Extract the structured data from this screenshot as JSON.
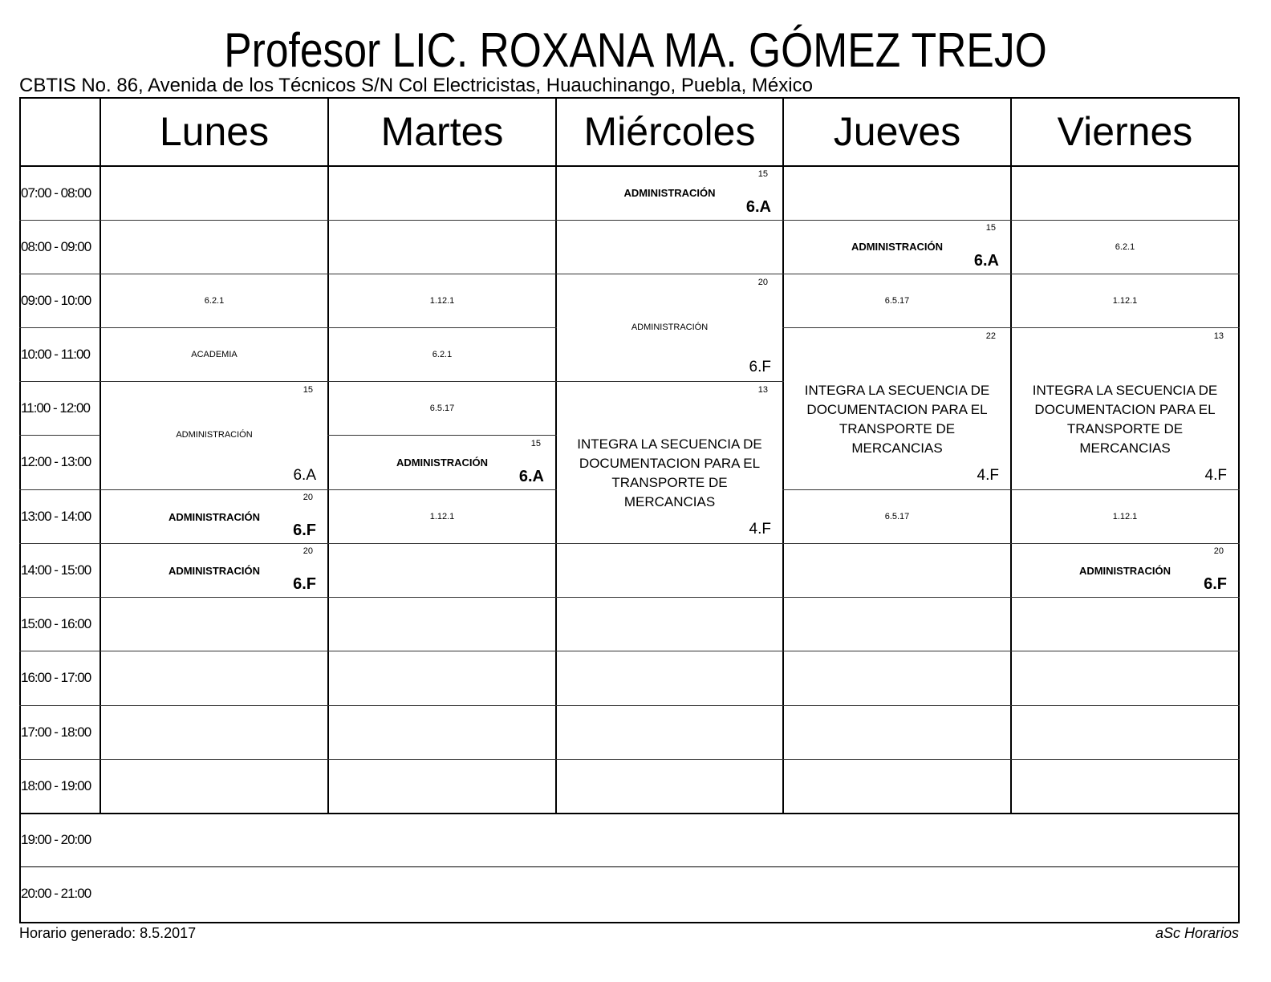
{
  "title": "Profesor LIC. ROXANA MA. GÓMEZ TREJO",
  "address": "CBTIS No. 86, Avenida de los Técnicos S/N Col Electricistas, Huauchinango, Puebla, México",
  "days": [
    "Lunes",
    "Martes",
    "Miércoles",
    "Jueves",
    "Viernes"
  ],
  "times": [
    "07:00 - 08:00",
    "08:00 - 09:00",
    "09:00 - 10:00",
    "10:00 - 11:00",
    "11:00 - 12:00",
    "12:00 - 13:00",
    "13:00 - 14:00",
    "14:00 - 15:00",
    "15:00 - 16:00",
    "16:00 - 17:00",
    "17:00 - 18:00",
    "18:00 - 19:00",
    "19:00 - 20:00",
    "20:00 - 21:00"
  ],
  "lessons": {
    "lun_0900": {
      "text": "6.2.1"
    },
    "lun_1000": {
      "text": "ACADEMIA"
    },
    "lun_1100": {
      "capacity": "15",
      "subject": "ADMINISTRACIÓN",
      "group": "6.A"
    },
    "lun_1300": {
      "capacity": "20",
      "subject": "ADMINISTRACIÓN",
      "group": "6.F"
    },
    "lun_1400": {
      "capacity": "20",
      "subject": "ADMINISTRACIÓN",
      "group": "6.F"
    },
    "mar_0900": {
      "text": "1.12.1"
    },
    "mar_1000": {
      "text": "6.2.1"
    },
    "mar_1100": {
      "text": "6.5.17"
    },
    "mar_1200": {
      "capacity": "15",
      "subject": "ADMINISTRACIÓN",
      "group": "6.A"
    },
    "mar_1300": {
      "text": "1.12.1"
    },
    "mie_0700": {
      "capacity": "15",
      "subject": "ADMINISTRACIÓN",
      "group": "6.A"
    },
    "mie_0900": {
      "capacity": "20",
      "subject": "ADMINISTRACIÓN",
      "group": "6.F"
    },
    "mie_1100": {
      "capacity": "13",
      "subject": "INTEGRA LA SECUENCIA DE DOCUMENTACION PARA EL TRANSPORTE DE MERCANCIAS",
      "group": "4.F"
    },
    "jue_0800": {
      "capacity": "15",
      "subject": "ADMINISTRACIÓN",
      "group": "6.A"
    },
    "jue_0900": {
      "text": "6.5.17"
    },
    "jue_1000": {
      "capacity": "22",
      "subject": "INTEGRA LA SECUENCIA DE DOCUMENTACION PARA EL TRANSPORTE DE MERCANCIAS",
      "group": "4.F"
    },
    "jue_1300": {
      "text": "6.5.17"
    },
    "vie_0800": {
      "text": "6.2.1"
    },
    "vie_0900": {
      "text": "1.12.1"
    },
    "vie_1000": {
      "capacity": "13",
      "subject": "INTEGRA LA SECUENCIA DE DOCUMENTACION PARA EL TRANSPORTE DE MERCANCIAS",
      "group": "4.F"
    },
    "vie_1300": {
      "text": "1.12.1"
    },
    "vie_1400": {
      "capacity": "20",
      "subject": "ADMINISTRACIÓN",
      "group": "6.F"
    }
  },
  "footer": {
    "generated": "Horario generado: 8.5.2017",
    "brand": "aSc Horarios"
  }
}
